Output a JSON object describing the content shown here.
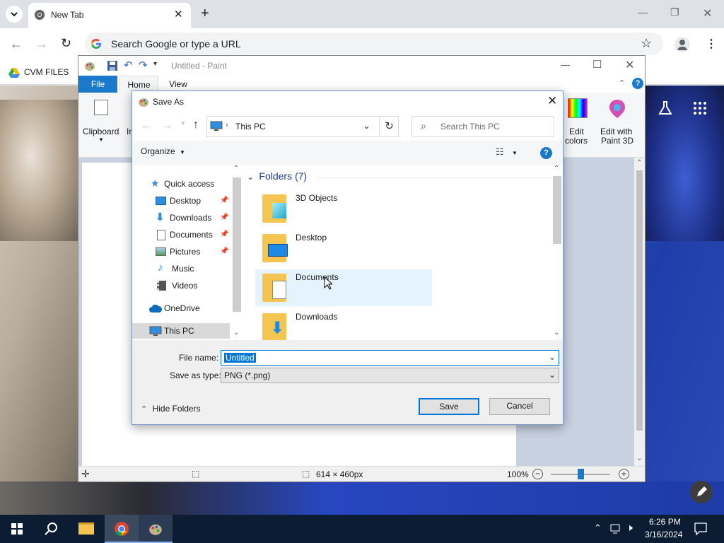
{
  "chrome": {
    "tab_title": "New Tab",
    "omnibox_placeholder": "Search Google or type a URL",
    "bookmark_label": "CVM FILES"
  },
  "paint": {
    "title": "Untitled - Paint",
    "tabs": [
      "File",
      "Home",
      "View"
    ],
    "ribbon": {
      "clipboard": "Clipboard",
      "image_partial": "Im",
      "edit_colors_line1": "Edit",
      "edit_colors_line2": "colors",
      "paint3d_line1": "Edit with",
      "paint3d_line2": "Paint 3D"
    },
    "status": {
      "size": "614 × 460px",
      "zoom": "100%"
    }
  },
  "dialog": {
    "title": "Save As",
    "address": "This PC",
    "search_placeholder": "Search This PC",
    "organize": "Organize",
    "nav": {
      "quick_access": "Quick access",
      "items": [
        {
          "label": "Desktop",
          "pinned": true
        },
        {
          "label": "Downloads",
          "pinned": true
        },
        {
          "label": "Documents",
          "pinned": true
        },
        {
          "label": "Pictures",
          "pinned": true
        },
        {
          "label": "Music",
          "pinned": false
        },
        {
          "label": "Videos",
          "pinned": false
        }
      ],
      "onedrive": "OneDrive",
      "this_pc": "This PC"
    },
    "group_header": "Folders (7)",
    "folders": [
      "3D Objects",
      "Desktop",
      "Documents",
      "Downloads"
    ],
    "file_name_label": "File name:",
    "file_name_value": "Untitled",
    "save_type_label": "Save as type:",
    "save_type_value": "PNG (*.png)",
    "hide_folders": "Hide Folders",
    "save_button": "Save",
    "cancel_button": "Cancel"
  },
  "taskbar": {
    "time": "6:26 PM",
    "date": "3/16/2024"
  },
  "colors": {
    "accent_blue": "#0078d7",
    "selection_bg": "#cce8ff",
    "taskbar": "#0b1c33"
  }
}
